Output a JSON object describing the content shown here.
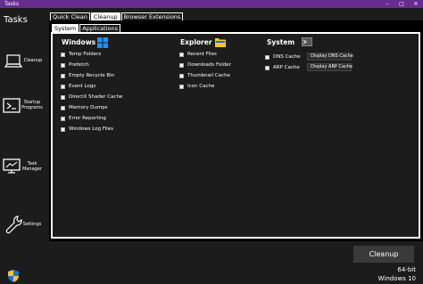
{
  "window": {
    "title": "Tasks",
    "controls": {
      "minimize": "–",
      "maximize": "□",
      "close": "✕"
    }
  },
  "sidebar": {
    "title": "Tasks",
    "items": [
      {
        "label": "Cleanup",
        "icon": "laptop-icon"
      },
      {
        "label": "Startup Programs",
        "icon": "terminal-icon"
      },
      {
        "label": "Task Manager",
        "icon": "monitor-chart-icon"
      },
      {
        "label": "Settings",
        "icon": "wrench-icon"
      }
    ]
  },
  "tabs": [
    "Quick Clean",
    "Cleanup",
    "Browser Extensions"
  ],
  "active_tab": "Cleanup",
  "subtabs": [
    "System",
    "Applications"
  ],
  "active_subtab": "System",
  "sections": {
    "windows": {
      "title": "Windows",
      "icon": "windows-logo-icon",
      "options": [
        "Temp Folders",
        "Prefetch",
        "Empty Recycle Bin",
        "Event Logs",
        "DirectX Shader Cache",
        "Memory Dumps",
        "Error Reporting",
        "Windows Log Files"
      ]
    },
    "explorer": {
      "title": "Explorer",
      "icon": "folder-icon",
      "options": [
        "Recent Files",
        "Downloads Folder",
        "Thumbnail Cache",
        "Icon Cache"
      ]
    },
    "system": {
      "title": "System",
      "icon": "console-icon",
      "options": [
        "DNS Cache",
        "ARP Cache"
      ],
      "buttons": [
        "Display DNS Cache",
        "Display ARP Cache"
      ]
    }
  },
  "footer": {
    "cleanup_button": "Cleanup",
    "arch": "64-bit",
    "os": "Windows 10"
  },
  "colors": {
    "titlebar": "#662d91",
    "background": "#1c1c1c",
    "panel": "#000000",
    "accent_blue": "#1e90ff",
    "folder_yellow": "#f4c430"
  }
}
